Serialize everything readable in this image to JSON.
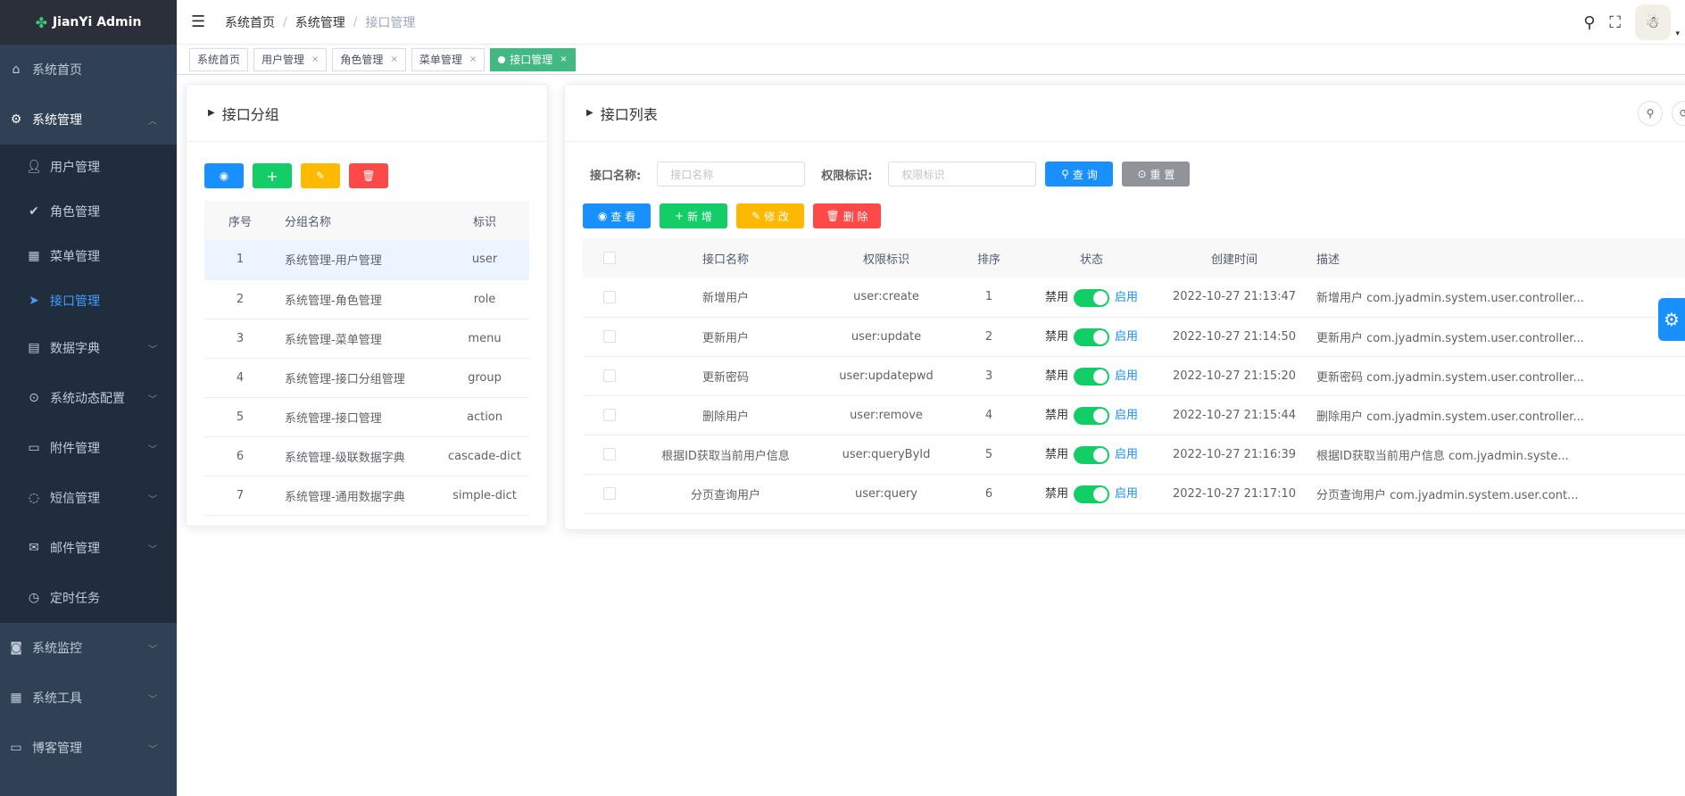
{
  "app": {
    "title": "JianYi Admin"
  },
  "sidebar": {
    "items": [
      {
        "label": "系统首页",
        "icon": "home-icon"
      },
      {
        "label": "系统管理",
        "icon": "gear-icon"
      },
      {
        "label": "数据字典",
        "icon": "book-icon"
      },
      {
        "label": "系统动态配置",
        "icon": "toggle-icon"
      },
      {
        "label": "附件管理",
        "icon": "folder-icon"
      },
      {
        "label": "短信管理",
        "icon": "chat-icon"
      },
      {
        "label": "邮件管理",
        "icon": "mail-icon"
      },
      {
        "label": "定时任务",
        "icon": "clock-icon"
      },
      {
        "label": "系统监控",
        "icon": "camera-icon"
      },
      {
        "label": "系统工具",
        "icon": "grid-icon"
      },
      {
        "label": "博客管理",
        "icon": "monitor-icon"
      }
    ],
    "sub_items": [
      {
        "label": "用户管理",
        "icon": "user-icon"
      },
      {
        "label": "角色管理",
        "icon": "check-circle-icon"
      },
      {
        "label": "菜单管理",
        "icon": "grid-icon"
      },
      {
        "label": "接口管理",
        "icon": "send-icon"
      }
    ]
  },
  "navbar": {
    "breadcrumb": [
      "系统首页",
      "系统管理",
      "接口管理"
    ]
  },
  "tags": [
    "系统首页",
    "用户管理",
    "角色管理",
    "菜单管理",
    "接口管理"
  ],
  "left_card": {
    "title": "接口分组",
    "columns": [
      "序号",
      "分组名称",
      "标识"
    ],
    "rows": [
      [
        "1",
        "系统管理-用户管理",
        "user"
      ],
      [
        "2",
        "系统管理-角色管理",
        "role"
      ],
      [
        "3",
        "系统管理-菜单管理",
        "menu"
      ],
      [
        "4",
        "系统管理-接口分组管理",
        "group"
      ],
      [
        "5",
        "系统管理-接口管理",
        "action"
      ],
      [
        "6",
        "系统管理-级联数据字典",
        "cascade-dict"
      ],
      [
        "7",
        "系统管理-通用数据字典",
        "simple-dict"
      ]
    ]
  },
  "right_card": {
    "title": "接口列表",
    "search": {
      "name_label": "接口名称:",
      "name_placeholder": "接口名称",
      "perm_label": "权限标识:",
      "perm_placeholder": "权限标识",
      "query_btn": "查 询",
      "reset_btn": "重 置"
    },
    "toolbar": {
      "view": "查 看",
      "add": "新 增",
      "edit": "修 改",
      "delete": "删 除"
    },
    "columns": [
      "接口名称",
      "权限标识",
      "排序",
      "状态",
      "创建时间",
      "描述"
    ],
    "status_off": "禁用",
    "status_on": "启用",
    "rows": [
      {
        "name": "新增用户",
        "perm": "user:create",
        "sort": "1",
        "time": "2022-10-27 21:13:47",
        "desc": "新增用户 com.jyadmin.system.user.controller..."
      },
      {
        "name": "更新用户",
        "perm": "user:update",
        "sort": "2",
        "time": "2022-10-27 21:14:50",
        "desc": "更新用户 com.jyadmin.system.user.controller..."
      },
      {
        "name": "更新密码",
        "perm": "user:updatepwd",
        "sort": "3",
        "time": "2022-10-27 21:15:20",
        "desc": "更新密码 com.jyadmin.system.user.controller..."
      },
      {
        "name": "删除用户",
        "perm": "user:remove",
        "sort": "4",
        "time": "2022-10-27 21:15:44",
        "desc": "删除用户 com.jyadmin.system.user.controller..."
      },
      {
        "name": "根据ID获取当前用户信息",
        "perm": "user:queryById",
        "sort": "5",
        "time": "2022-10-27 21:16:39",
        "desc": "根据ID获取当前用户信息 com.jyadmin.syste..."
      },
      {
        "name": "分页查询用户",
        "perm": "user:query",
        "sort": "6",
        "time": "2022-10-27 21:17:10",
        "desc": "分页查询用户 com.jyadmin.system.user.cont..."
      }
    ]
  },
  "colors": {
    "primary": "#1890ff",
    "success": "#13ce66",
    "warning": "#ffba00",
    "danger": "#ff4949",
    "sidebar": "#304156",
    "tag_active": "#42b983"
  }
}
